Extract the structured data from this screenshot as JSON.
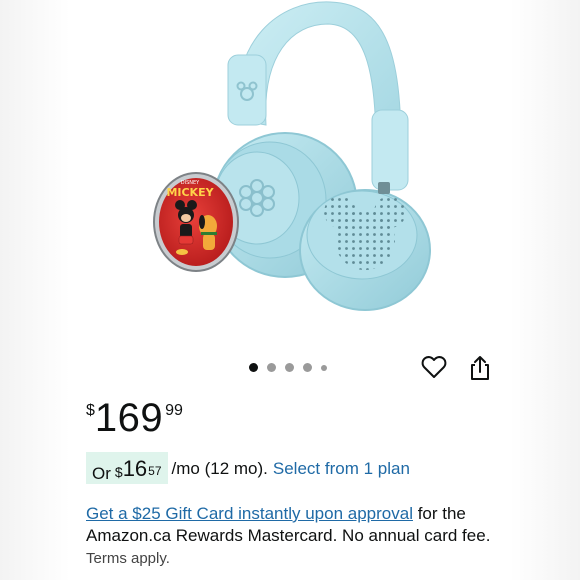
{
  "product": {
    "image_alt": "Light blue Disney headphones with Mickey and Pluto ear disc",
    "image_text": {
      "disc_brand": "DISNEY",
      "disc_title": "MICKEY",
      "band_brand": "Disney"
    }
  },
  "carousel": {
    "count": 5,
    "active_index": 0
  },
  "actions": {
    "heart_icon": "heart-icon",
    "share_icon": "share-icon"
  },
  "price": {
    "currency_symbol": "$",
    "whole": "169",
    "fraction": "99"
  },
  "financing": {
    "or_label": "Or",
    "currency_symbol": "$",
    "whole": "16",
    "fraction": "57",
    "term": "/mo (12 mo).",
    "plan_link": "Select from 1 plan"
  },
  "promo": {
    "link_text": "Get a $25 Gift Card instantly upon approval",
    "body_text": " for the Amazon.ca Rewards Mastercard. No annual card fee.",
    "terms": "Terms apply."
  },
  "colors": {
    "headphone_blue": "#b8e3ec",
    "link_blue": "#1f6aa6",
    "highlight_green": "#dff4ec",
    "disc_red": "#d42b2b"
  }
}
